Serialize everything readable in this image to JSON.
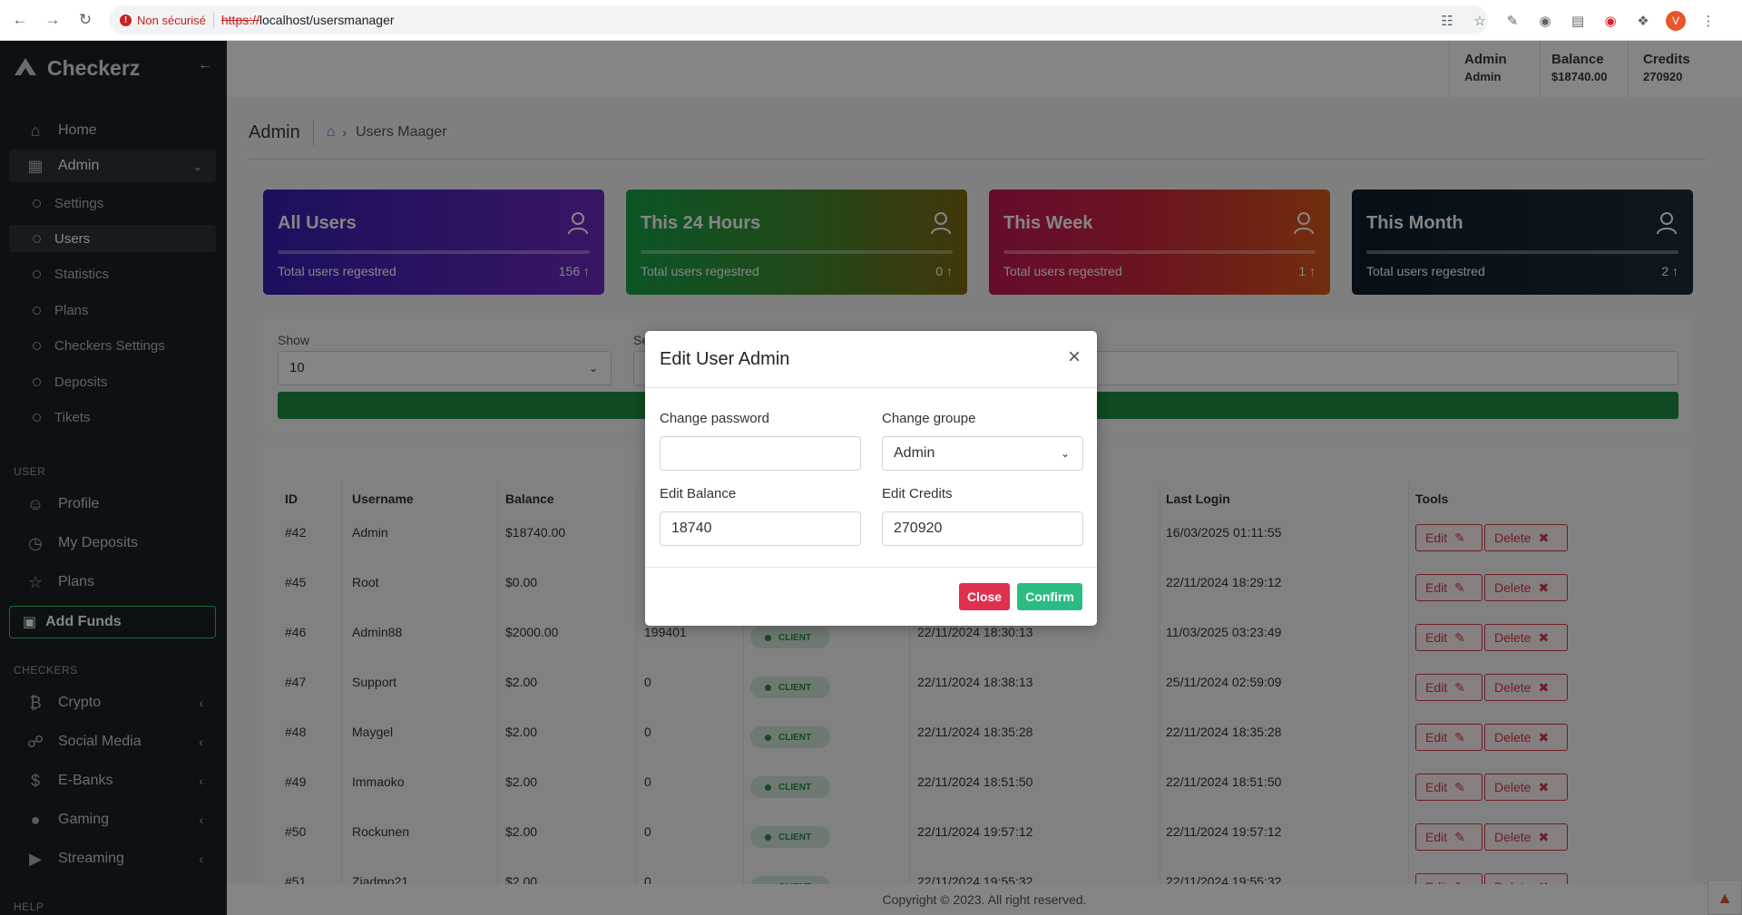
{
  "browser": {
    "security_label": "Non sécurisé",
    "url_protocol": "https://",
    "url_host": "localhost/usersmanager",
    "profile_initial": "V"
  },
  "sidebar": {
    "brand": "Checkerz",
    "items": [
      {
        "label": "Home",
        "icon": "home-icon"
      },
      {
        "label": "Admin",
        "icon": "grid-icon"
      }
    ],
    "admin_sub": [
      "Settings",
      "Users",
      "Statistics",
      "Plans",
      "Checkers Settings",
      "Deposits",
      "Tikets"
    ],
    "section_user": "USER",
    "user_items": [
      "Profile",
      "My Deposits",
      "Plans"
    ],
    "add_funds": "Add Funds",
    "section_checkers": "CHECKERS",
    "checker_items": [
      "Crypto",
      "Social Media",
      "E-Banks",
      "Gaming",
      "Streaming"
    ],
    "section_help": "HELP"
  },
  "topbar": {
    "user_label": "Admin",
    "user_value": "Admin",
    "balance_label": "Balance",
    "balance_value": "$18740.00",
    "credits_label": "Credits",
    "credits_value": "270920"
  },
  "breadcrumb": {
    "title": "Admin",
    "crumb": "Users Maager"
  },
  "cards": [
    {
      "title": "All Users",
      "sub": "Total users regestred",
      "count": "156"
    },
    {
      "title": "This 24 Hours",
      "sub": "Total users regestred",
      "count": "0"
    },
    {
      "title": "This Week",
      "sub": "Total users regestred",
      "count": "1"
    },
    {
      "title": "This Month",
      "sub": "Total users regestred",
      "count": "2"
    }
  ],
  "filters": {
    "show_label": "Show",
    "show_value": "10",
    "search_label": "Se"
  },
  "table": {
    "headers": {
      "id": "ID",
      "username": "Username",
      "balance": "Balance",
      "last_login": "Last Login",
      "tools": "Tools"
    },
    "edit_label": "Edit",
    "delete_label": "Delete",
    "rows": [
      {
        "id": "#42",
        "username": "Admin",
        "balance": "$18740.00",
        "credits": "",
        "group": "",
        "created": "",
        "last_login": "16/03/2025 01:11:55"
      },
      {
        "id": "#45",
        "username": "Root",
        "balance": "$0.00",
        "credits": "",
        "group": "",
        "created": "",
        "last_login": "22/11/2024 18:29:12"
      },
      {
        "id": "#46",
        "username": "Admin88",
        "balance": "$2000.00",
        "credits": "199401",
        "group": "CLIENT",
        "created": "22/11/2024 18:30:13",
        "last_login": "11/03/2025 03:23:49"
      },
      {
        "id": "#47",
        "username": "Support",
        "balance": "$2.00",
        "credits": "0",
        "group": "CLIENT",
        "created": "22/11/2024 18:38:13",
        "last_login": "25/11/2024 02:59:09"
      },
      {
        "id": "#48",
        "username": "Maygel",
        "balance": "$2.00",
        "credits": "0",
        "group": "CLIENT",
        "created": "22/11/2024 18:35:28",
        "last_login": "22/11/2024 18:35:28"
      },
      {
        "id": "#49",
        "username": "Immaoko",
        "balance": "$2.00",
        "credits": "0",
        "group": "CLIENT",
        "created": "22/11/2024 18:51:50",
        "last_login": "22/11/2024 18:51:50"
      },
      {
        "id": "#50",
        "username": "Rockunen",
        "balance": "$2.00",
        "credits": "0",
        "group": "CLIENT",
        "created": "22/11/2024 19:57:12",
        "last_login": "22/11/2024 19:57:12"
      },
      {
        "id": "#51",
        "username": "Ziadmo21",
        "balance": "$2.00",
        "credits": "0",
        "group": "CLIENT",
        "created": "22/11/2024 19:55:32",
        "last_login": "22/11/2024 19:55:32"
      }
    ]
  },
  "footer": "Copyright © 2023. All right reserved.",
  "modal": {
    "title": "Edit User Admin",
    "password_label": "Change password",
    "password_value": "",
    "group_label": "Change groupe",
    "group_value": "Admin",
    "balance_label": "Edit Balance",
    "balance_value": "18740",
    "credits_label": "Edit Credits",
    "credits_value": "270920",
    "close_label": "Close",
    "confirm_label": "Confirm"
  }
}
